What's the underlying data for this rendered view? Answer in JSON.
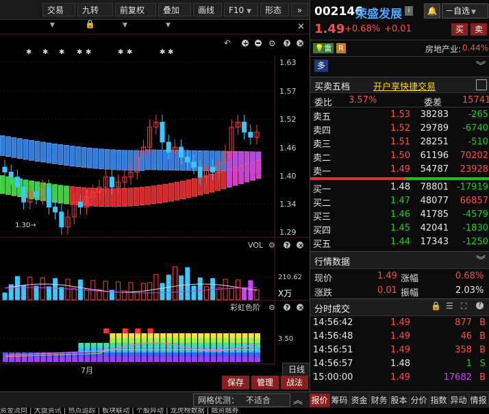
{
  "toolbar": {
    "buttons": [
      "交易",
      "九转",
      "前复权",
      "叠加",
      "画线",
      "F10",
      "形态"
    ],
    "more": "»"
  },
  "chart": {
    "price_axis": [
      "1.63",
      "1.57",
      "1.52",
      "1.46",
      "1.40",
      "1.34",
      "1.29"
    ],
    "low_marker": "1.30",
    "vol_label": "VOL",
    "vol_value": "210.62",
    "vol_unit": "X万",
    "rainbow_label": "彩虹色阶",
    "rainbow_value": "3.50",
    "date_label": "7月",
    "period_label": "日线",
    "buttons": [
      "保存",
      "管理",
      "战法"
    ],
    "chart_data": {
      "type": "candlestick",
      "close": [
        1.41,
        1.4,
        1.38,
        1.35,
        1.37,
        1.36,
        1.38,
        1.34,
        1.33,
        1.3,
        1.32,
        1.35,
        1.34,
        1.36,
        1.37,
        1.38,
        1.4,
        1.38,
        1.39,
        1.4,
        1.41,
        1.44,
        1.46,
        1.5,
        1.51,
        1.47,
        1.45,
        1.46,
        1.44,
        1.43,
        1.42,
        1.4,
        1.42,
        1.41,
        1.43,
        1.45,
        1.5,
        1.51,
        1.49,
        1.48,
        1.49
      ],
      "ylim": [
        1.29,
        1.63
      ]
    }
  },
  "stock": {
    "code": "002146",
    "name": "荣盛发展",
    "info_icon": "i",
    "price": "1.49",
    "change_pct": "+0.68%",
    "change": "+0.01",
    "buy_btn": "买",
    "sell_btn": "卖",
    "watch_btn": "自选",
    "tag_rong": "雷",
    "tag_r": "R",
    "industry": "房地产业:",
    "industry_pct": "0.44%",
    "duo": "多"
  },
  "order_book": {
    "title": "买卖五档",
    "link": "开户享快捷交易",
    "ratio_label": "委比",
    "ratio_value": "3.57%",
    "diff_label": "委差",
    "diff_value": "15741",
    "asks": [
      {
        "label": "卖五",
        "price": "1.53",
        "vol": "38283",
        "chg": "-265"
      },
      {
        "label": "卖四",
        "price": "1.52",
        "vol": "29789",
        "chg": "-6740"
      },
      {
        "label": "卖三",
        "price": "1.51",
        "vol": "28251",
        "chg": "-510"
      },
      {
        "label": "卖二",
        "price": "1.50",
        "vol": "61196",
        "chg": "70202"
      },
      {
        "label": "卖一",
        "price": "1.49",
        "vol": "54787",
        "chg": "23928"
      }
    ],
    "bids": [
      {
        "label": "买一",
        "price": "1.48",
        "vol": "78801",
        "chg": "-17919"
      },
      {
        "label": "买二",
        "price": "1.47",
        "vol": "48077",
        "chg": "66857"
      },
      {
        "label": "买三",
        "price": "1.46",
        "vol": "41785",
        "chg": "-4579"
      },
      {
        "label": "买四",
        "price": "1.45",
        "vol": "42041",
        "chg": "-1830"
      },
      {
        "label": "买五",
        "price": "1.44",
        "vol": "17343",
        "chg": "-1250"
      }
    ]
  },
  "quote": {
    "title": "行情数据",
    "now_label": "现价",
    "now_value": "1.49",
    "amp_label": "涨幅",
    "amp_value": "0.68%",
    "chg_label": "涨跌",
    "chg_value": "0.01",
    "swing_label": "振幅",
    "swing_value": "2.03%"
  },
  "ticks": {
    "title": "分时成交",
    "rows": [
      {
        "time": "14:56:42",
        "price": "1.49",
        "vol": "877",
        "side": "B"
      },
      {
        "time": "14:56:48",
        "price": "1.49",
        "vol": "46",
        "side": "B"
      },
      {
        "time": "14:56:51",
        "price": "1.49",
        "vol": "358",
        "side": "B"
      },
      {
        "time": "14:56:57",
        "price": "1.48",
        "vol": "1",
        "side": "S"
      },
      {
        "time": "15:00:00",
        "price": "1.49",
        "vol": "17682",
        "side": "B"
      }
    ]
  },
  "bottom": {
    "grid_label": "网格优测：",
    "grid_value": "不适合",
    "tabs": [
      "报价",
      "筹码",
      "资金",
      "财务",
      "股本",
      "分价",
      "指数",
      "异动",
      "情报"
    ]
  },
  "ticker": "资金流向 | 大盘资讯 | 热点追踪 | 板块联动 | 个股异动 | 龙虎榜数据 | 融资融券"
}
